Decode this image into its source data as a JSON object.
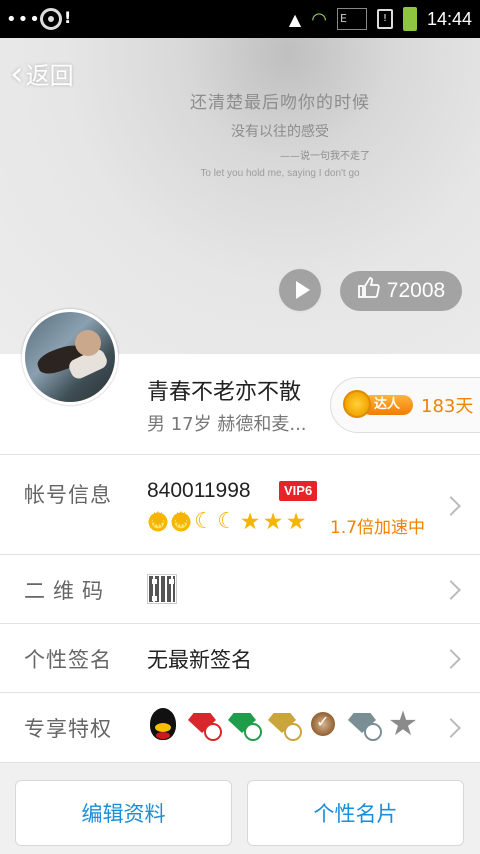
{
  "status_bar": {
    "time": "14:44",
    "signal_label": "E",
    "icons": [
      "more-dots-icon",
      "disc-icon",
      "alert-icon",
      "image-icon",
      "wifi-icon",
      "signal-icon",
      "sim-alert-icon",
      "battery-charging-icon"
    ]
  },
  "header": {
    "back_label": "返回"
  },
  "cover": {
    "line1": "还清楚最后吻你的时候",
    "line2": "没有以往的感受",
    "line3": "——说一句我不走了",
    "line4": "To let you hold me, saying I don't go"
  },
  "likes": {
    "count": "72008"
  },
  "profile": {
    "nickname": "青春不老亦不散",
    "subline": "男 17岁 赫德和麦...",
    "expert_badge": "达人",
    "expert_days": "183天"
  },
  "rows": {
    "account": {
      "label": "帐号信息",
      "qq_number": "840011998",
      "vip_badge": "VIP6",
      "speed": "1.7倍加速中",
      "level_icons": [
        "sun",
        "sun",
        "moon",
        "moon",
        "star",
        "star",
        "star"
      ]
    },
    "qr": {
      "label": "二维码"
    },
    "signature": {
      "label": "个性签名",
      "value": "无最新签名"
    },
    "privileges": {
      "label": "专享特权",
      "icons": [
        "qq-penguin-icon",
        "red-diamond-icon",
        "green-diamond-icon",
        "yellow-diamond-icon",
        "brown-diamond-icon",
        "blue-diamond-icon",
        "star-icon"
      ]
    }
  },
  "bottom": {
    "edit_label": "编辑资料",
    "card_label": "个性名片"
  },
  "colors": {
    "accent_blue": "#1a8ed8",
    "orange": "#f08300",
    "vip_red": "#e5232a"
  }
}
